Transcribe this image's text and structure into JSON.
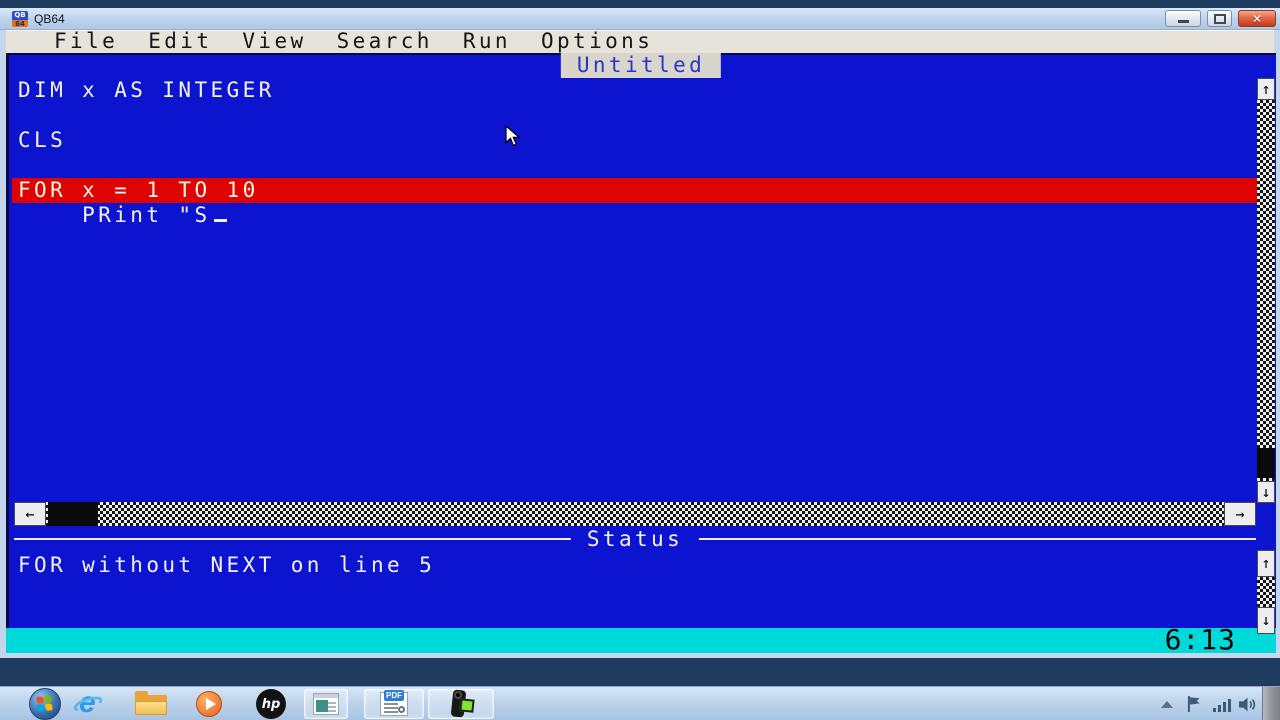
{
  "window": {
    "title": "QB64",
    "icon_top": "QB",
    "icon_bottom": "64"
  },
  "menu": {
    "items": [
      "File",
      "Edit",
      "View",
      "Search",
      "Run",
      "Options"
    ]
  },
  "editor": {
    "doc_title": "Untitled",
    "code_lines": [
      {
        "text": "DIM x AS INTEGER"
      },
      {
        "text": ""
      },
      {
        "text": "CLS"
      },
      {
        "text": ""
      },
      {
        "text": "FOR x = 1 TO 10",
        "highlighted": true
      },
      {
        "text": "    PRint \"S",
        "cursor": true
      }
    ]
  },
  "status": {
    "panel_title": "Status",
    "message": "FOR without NEXT on line 5"
  },
  "statusline": {
    "cursor_position": "6:13"
  },
  "icons": {
    "close": "✕",
    "scroll_up": "↑",
    "scroll_down": "↓",
    "scroll_left": "←",
    "scroll_right": "→",
    "ie_glyph": "e"
  },
  "taskbar": {
    "hp_label": "hp",
    "pdf_label": "PDF",
    "items": [
      "start",
      "internet-explorer",
      "file-explorer",
      "media-player",
      "hp",
      "qb64-ide",
      "pdf-reader",
      "camera-app"
    ],
    "tray": [
      "show-hidden-icons",
      "action-center-flag",
      "network-signal",
      "volume",
      "show-desktop"
    ]
  },
  "colors": {
    "editor_background": "#0C14D0",
    "error_highlight": "#DF0404",
    "status_line_background": "#00D9D9",
    "desktop": "#1E3B60",
    "menu_bar": "#E7E3DB",
    "doc_tab_text": "#2636C8"
  }
}
